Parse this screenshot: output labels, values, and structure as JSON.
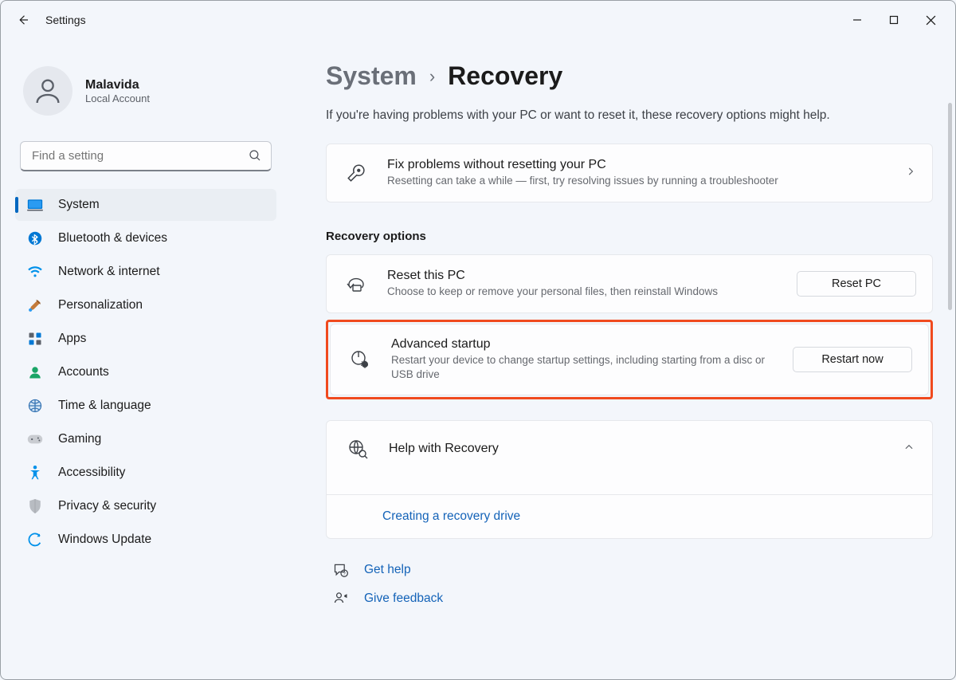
{
  "window": {
    "app_title": "Settings"
  },
  "user": {
    "name": "Malavida",
    "subtitle": "Local Account"
  },
  "search": {
    "placeholder": "Find a setting"
  },
  "sidebar": {
    "items": [
      {
        "label": "System"
      },
      {
        "label": "Bluetooth & devices"
      },
      {
        "label": "Network & internet"
      },
      {
        "label": "Personalization"
      },
      {
        "label": "Apps"
      },
      {
        "label": "Accounts"
      },
      {
        "label": "Time & language"
      },
      {
        "label": "Gaming"
      },
      {
        "label": "Accessibility"
      },
      {
        "label": "Privacy & security"
      },
      {
        "label": "Windows Update"
      }
    ]
  },
  "breadcrumb": {
    "parent": "System",
    "current": "Recovery"
  },
  "intro": "If you're having problems with your PC or want to reset it, these recovery options might help.",
  "fix_card": {
    "title": "Fix problems without resetting your PC",
    "desc": "Resetting can take a while — first, try resolving issues by running a troubleshooter"
  },
  "section_header": "Recovery options",
  "reset_card": {
    "title": "Reset this PC",
    "desc": "Choose to keep or remove your personal files, then reinstall Windows",
    "button": "Reset PC"
  },
  "advanced_card": {
    "title": "Advanced startup",
    "desc": "Restart your device to change startup settings, including starting from a disc or USB drive",
    "button": "Restart now"
  },
  "help_card": {
    "title": "Help with Recovery",
    "link": "Creating a recovery drive"
  },
  "footer": {
    "get_help": "Get help",
    "give_feedback": "Give feedback"
  }
}
